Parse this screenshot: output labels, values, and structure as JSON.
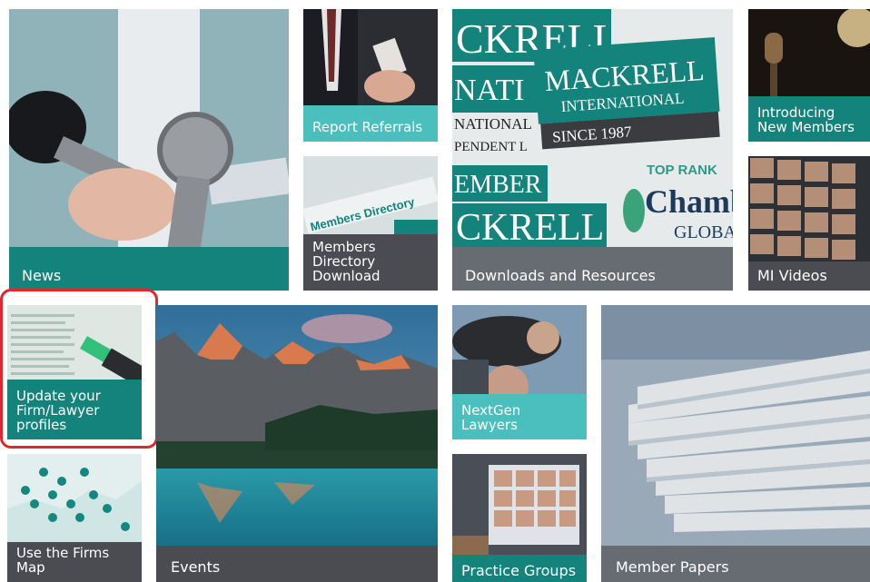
{
  "tiles": {
    "news": {
      "label": "News"
    },
    "report_referrals": {
      "label": "Report Referrals"
    },
    "downloads": {
      "label": "Downloads and Resources",
      "banner_top": "CKRELL",
      "banner_left": "NATI",
      "brand_main": "MACKRELL",
      "brand_sub": "INTERNATIONAL",
      "since": "SINCE 1987",
      "national": "NATIONAL",
      "independent": "PENDENT L",
      "member": "EMBER",
      "banner_bottom": "CKRELL",
      "top_rank": "TOP RANK",
      "chambers": "Chamb",
      "global": "GLOBA"
    },
    "introducing": {
      "label": "Introducing\nNew Members"
    },
    "members_directory": {
      "label": "Members\nDirectory\nDownload",
      "img_text": "Members Directory"
    },
    "mi_videos": {
      "label": "MI Videos"
    },
    "update_profiles": {
      "label": "Update your\nFirm/Lawyer\nprofiles"
    },
    "events": {
      "label": "Events"
    },
    "nextgen": {
      "label": "NextGen\nLawyers"
    },
    "member_papers": {
      "label": "Member Papers"
    },
    "firms_map": {
      "label": "Use the Firms\nMap"
    },
    "practice_groups": {
      "label": "Practice Groups"
    }
  },
  "colors": {
    "teal": "#14837c",
    "teal_light": "#4bbfbd",
    "dark_label": "#4a4c52",
    "grey_label": "#676b72",
    "highlight": "#e0282c"
  }
}
